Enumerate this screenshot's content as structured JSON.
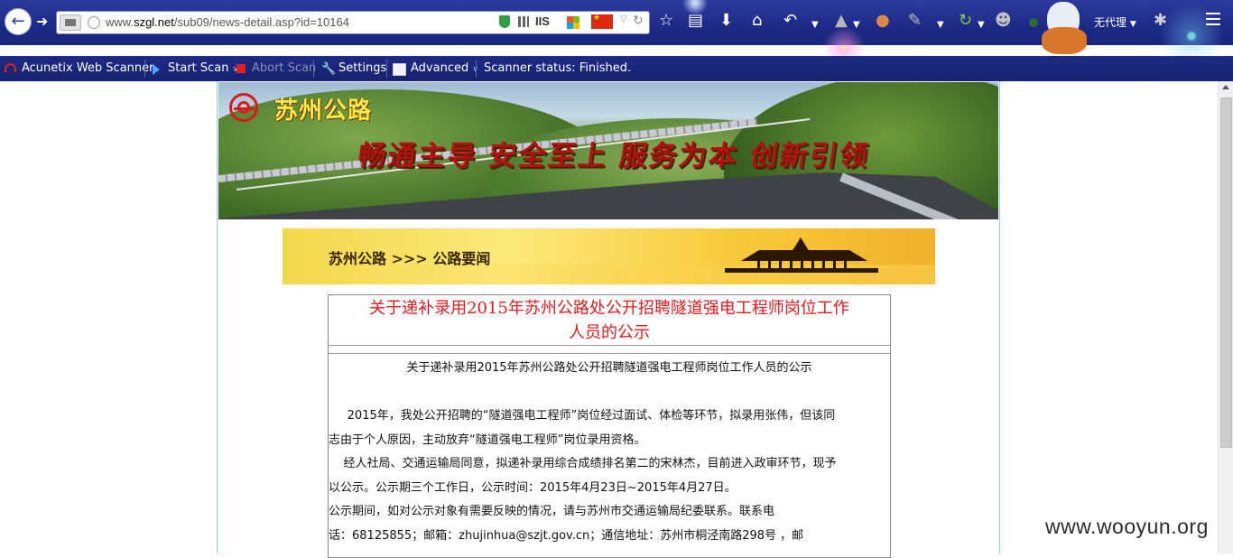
{
  "browser": {
    "url_prefix": "www.",
    "url_domain": "szgl.net",
    "url_path": "/sub09/news-detail.asp?id=10164",
    "iis_label": "IIS",
    "proxy_label": "无代理"
  },
  "toolbar": {
    "app_label": "Acunetix Web Scanner",
    "start_label": "Start Scan",
    "abort_label": "Abort Scan",
    "settings_label": "Settings",
    "advanced_label": "Advanced",
    "status_text": "Scanner status: Finished."
  },
  "site": {
    "name": "苏州公路",
    "slogan": "畅通主导 安全至上 服务为本 创新引领",
    "breadcrumb": "苏州公路 >>> 公路要闻"
  },
  "article": {
    "title_line1": "关于递补录用2015年苏州公路处公开招聘隧道强电工程师岗位工作",
    "title_line2": "人员的公示",
    "subtitle": "关于递补录用2015年苏州公路处公开招聘隧道强电工程师岗位工作人员的公示",
    "p1_line1": "     2015年，我处公开招聘的“隧道强电工程师”岗位经过面试、体检等环节，拟录用张伟，但该同",
    "p1_line2": "志由于个人原因，主动放弃“隧道强电工程师”岗位录用资格。",
    "p2_line1": "    经人社局、交通运输局同意，拟递补录用综合成绩排名第二的宋林杰，目前进入政审环节，现予",
    "p2_line2": "以公示。公示期三个工作日，公示时间：2015年4月23日~2015年4月27日。",
    "p3_line1": "公示期间，如对公示对象有需要反映的情况，请与苏州市交通运输局纪委联系。联系电",
    "p3_line2": "话：68125855；邮箱：zhujinhua@szjt.gov.cn；通信地址：苏州市桐泾南路298号 ，邮"
  },
  "watermark": "www.wooyun.org"
}
